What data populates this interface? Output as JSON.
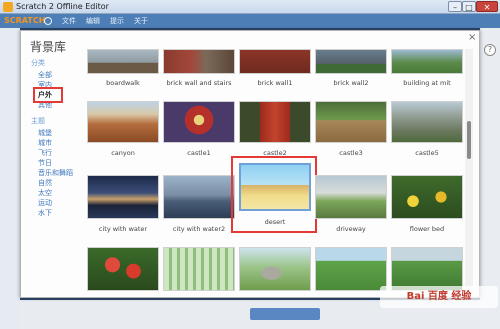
{
  "window": {
    "title": "Scratch 2 Offline Editor",
    "min": "–",
    "max": "□",
    "close": "✕"
  },
  "menubar": {
    "logo": "SCRATCH",
    "file": "文件",
    "edit": "编辑",
    "tips": "提示",
    "about": "关于"
  },
  "dialog": {
    "title": "背景库",
    "close": "×"
  },
  "categories": {
    "group1": "分类",
    "items1": [
      "全部",
      "室内",
      "户外",
      "其他"
    ],
    "group2": "主题",
    "items2": [
      "城堡",
      "城市",
      "飞行",
      "节日",
      "音乐和舞蹈",
      "自然",
      "太空",
      "运动",
      "水下"
    ]
  },
  "tiles": [
    {
      "label": "boardwalk"
    },
    {
      "label": "brick wall and stairs"
    },
    {
      "label": "brick wall1"
    },
    {
      "label": "brick wall2"
    },
    {
      "label": "building at mit"
    },
    {
      "label": "canyon"
    },
    {
      "label": "castle1"
    },
    {
      "label": "castle2"
    },
    {
      "label": "castle3"
    },
    {
      "label": "castle5"
    },
    {
      "label": "city with water"
    },
    {
      "label": "city with water2"
    },
    {
      "label": "desert"
    },
    {
      "label": "driveway"
    },
    {
      "label": "flower bed"
    },
    {
      "label": ""
    },
    {
      "label": ""
    },
    {
      "label": ""
    },
    {
      "label": ""
    },
    {
      "label": ""
    }
  ],
  "help": "?",
  "watermark": "Bai 百度 经验"
}
